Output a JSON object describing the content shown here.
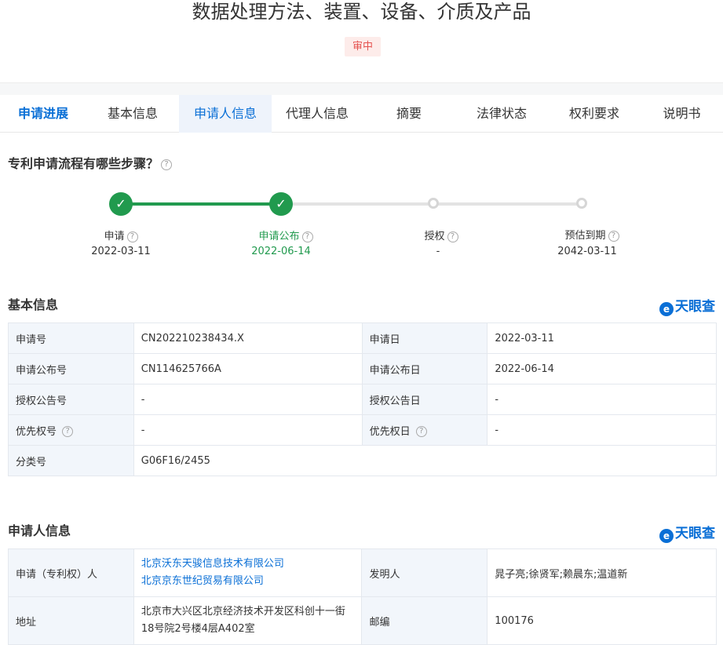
{
  "header": {
    "title": "数据处理方法、装置、设备、介质及产品",
    "status": "审中"
  },
  "tabs": [
    "申请进展",
    "基本信息",
    "申请人信息",
    "代理人信息",
    "摘要",
    "法律状态",
    "权利要求",
    "说明书"
  ],
  "progress": {
    "heading": "专利申请流程有哪些步骤？",
    "steps": [
      {
        "label": "申请",
        "date": "2022-03-11",
        "state": "done"
      },
      {
        "label": "申请公布",
        "date": "2022-06-14",
        "state": "done"
      },
      {
        "label": "授权",
        "date": "-",
        "state": "pending"
      },
      {
        "label": "预估到期",
        "date": "2042-03-11",
        "state": "pending"
      }
    ]
  },
  "basic_info": {
    "heading": "基本信息",
    "logo": "天眼查",
    "rows": [
      {
        "k1": "申请号",
        "v1": "CN202210238434.X",
        "k2": "申请日",
        "v2": "2022-03-11"
      },
      {
        "k1": "申请公布号",
        "v1": "CN114625766A",
        "k2": "申请公布日",
        "v2": "2022-06-14"
      },
      {
        "k1": "授权公告号",
        "v1": "-",
        "k2": "授权公告日",
        "v2": "-"
      },
      {
        "k1": "优先权号",
        "v1": "-",
        "k2": "优先权日",
        "v2": "-"
      },
      {
        "k1": "分类号",
        "v1": "G06F16/2455"
      }
    ]
  },
  "applicant_info": {
    "heading": "申请人信息",
    "logo": "天眼查",
    "applicant_label": "申请（专利权）人",
    "applicants": [
      "北京沃东天骏信息技术有限公司",
      "北京京东世纪贸易有限公司"
    ],
    "inventor_label": "发明人",
    "inventors": "晁子亮;徐贤军;赖晨东;温道新",
    "address_label": "地址",
    "address": "北京市大兴区北京经济技术开发区科创十一街18号院2号楼4层A402室",
    "postcode_label": "邮编",
    "postcode": "100176"
  },
  "icons": {
    "help": "question-circle-icon",
    "check": "check-icon",
    "logo": "tianyancha-logo-icon"
  },
  "colors": {
    "accent": "#0a6fd6",
    "success": "#219a4e",
    "status_red": "#e55350"
  }
}
